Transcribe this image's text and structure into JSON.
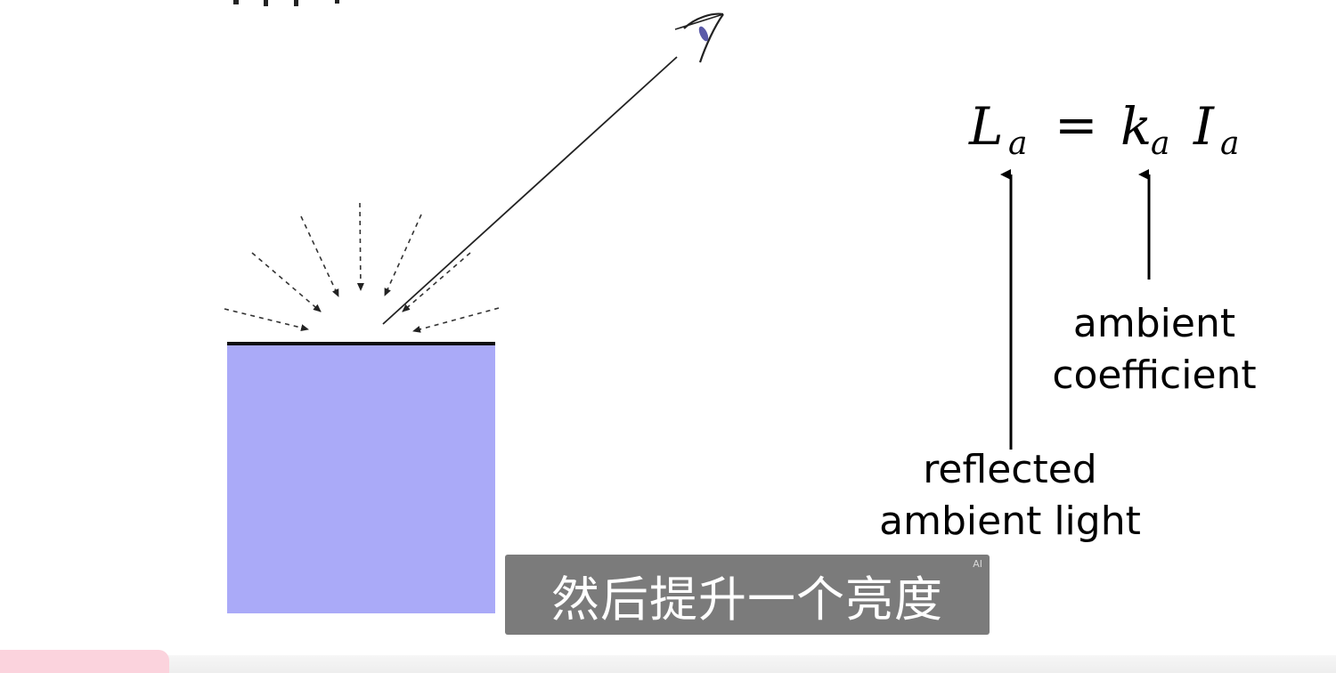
{
  "equation": {
    "lhs": "L",
    "lhs_sub": "a",
    "equals": "=",
    "coef": "k",
    "coef_sub": "a",
    "intensity": "I",
    "intensity_sub": "a"
  },
  "annotations": {
    "reflected_line1": "reflected",
    "reflected_line2": "ambient light",
    "coef_line1": "ambient",
    "coef_line2": "coefficient"
  },
  "subtitle": {
    "text": "然后提升一个亮度",
    "badge": "AI"
  },
  "colors": {
    "surface_fill": "#aaaaf8",
    "surface_edge": "#111111",
    "subtitle_bg": "#6a6a6a",
    "pink_tab": "#fbd3dd"
  }
}
